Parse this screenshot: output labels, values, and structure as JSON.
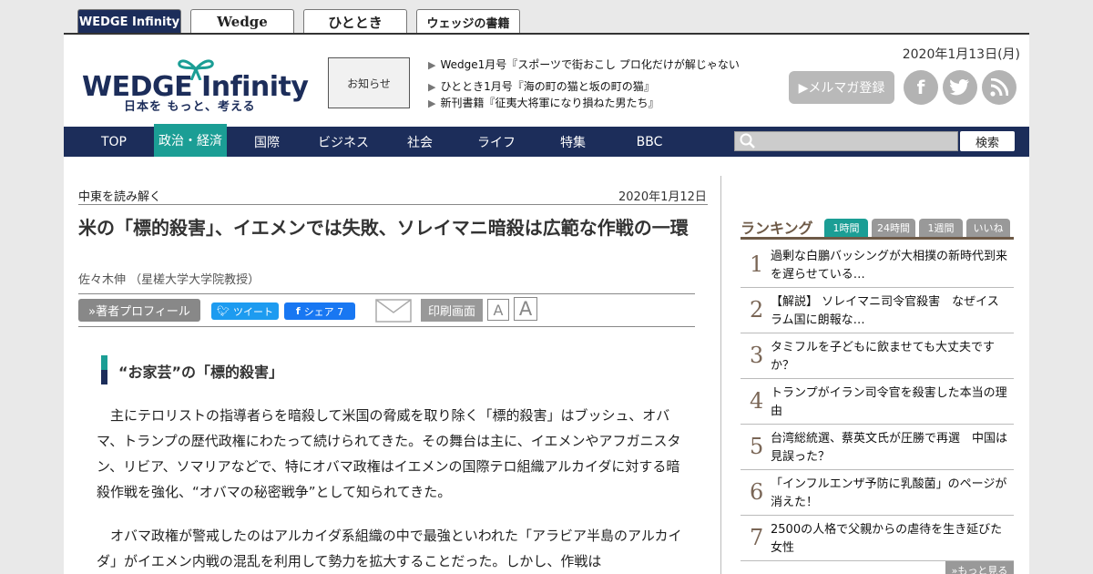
{
  "site_tabs": [
    "WEDGE Infinity",
    "Wedge",
    "ひととき",
    "ウェッジの書籍"
  ],
  "logo": {
    "main": "WEDGE Infinity",
    "sub": "日本を もっと、考える"
  },
  "notice": "お知らせ",
  "news": [
    "Wedge1月号『スポーツで街おこし プロ化だけが解じゃない",
    "ひととき1月号『海の町の猫と坂の町の猫』",
    "新刊書籍『征夷大将軍になり損ねた男たち』"
  ],
  "header_date": "2020年1月13日(月)",
  "newsletter_button": "▶メルマガ登録",
  "social": {
    "facebook": "f",
    "twitter": "t",
    "rss": "rss"
  },
  "nav": [
    "TOP",
    "政治・経済",
    "国際",
    "ビジネス",
    "社会",
    "ライフ",
    "特集",
    "BBC"
  ],
  "search": {
    "placeholder": "",
    "button": "検索"
  },
  "article": {
    "category": "中東を読み解く",
    "date": "2020年1月12日",
    "title": "米の「標的殺害」、イエメンでは失敗、ソレイマニ暗殺は広範な作戦の一環",
    "author": "佐々木伸 （星槎大学大学院教授）",
    "profile_button": "»著者プロフィール",
    "tweet_button": "ツイート",
    "share_button": "シェア 7",
    "print_button": "印刷画面",
    "font_small": "A",
    "font_large": "A",
    "subheading": "“お家芸”の「標的殺害」",
    "paragraphs": [
      "主にテロリストの指導者らを暗殺して米国の脅威を取り除く「標的殺害」はブッシュ、オバマ、トランプの歴代政権にわたって続けられてきた。その舞台は主に、イエメンやアフガニスタン、リビア、ソマリアなどで、特にオバマ政権はイエメンの国際テロ組織アルカイダに対する暗殺作戦を強化、“オバマの秘密戦争”として知られてきた。",
      "オバマ政権が警戒したのはアルカイダ系組織の中で最強といわれた「アラビア半島のアルカイダ」がイエメン内戦の混乱を利用して勢力を拡大することだった。しかし、作戦は"
    ]
  },
  "ranking": {
    "title": "ランキング",
    "tabs": [
      "1時間",
      "24時間",
      "1週間",
      "いいね"
    ],
    "items": [
      {
        "rank": "1",
        "text": "過剰な白鵬バッシングが大相撲の新時代到来を遅らせている…"
      },
      {
        "rank": "2",
        "text": "【解説】 ソレイマニ司令官殺害　なぜイスラム国に朗報な…"
      },
      {
        "rank": "3",
        "text": "タミフルを子どもに飲ませても大丈夫ですか？"
      },
      {
        "rank": "4",
        "text": "トランプがイラン司令官を殺害した本当の理由"
      },
      {
        "rank": "5",
        "text": "台湾総統選、蔡英文氏が圧勝で再選　中国は見誤った？"
      },
      {
        "rank": "6",
        "text": "「インフルエンザ予防に乳酸菌」のページが消えた！"
      },
      {
        "rank": "7",
        "text": "2500の人格で父親からの虐待を生き延びた女性"
      }
    ],
    "more": "»もっと見る"
  },
  "colors": {
    "navy": "#1c2d5a",
    "teal": "#1b9e95",
    "brown": "#6e5a47"
  }
}
